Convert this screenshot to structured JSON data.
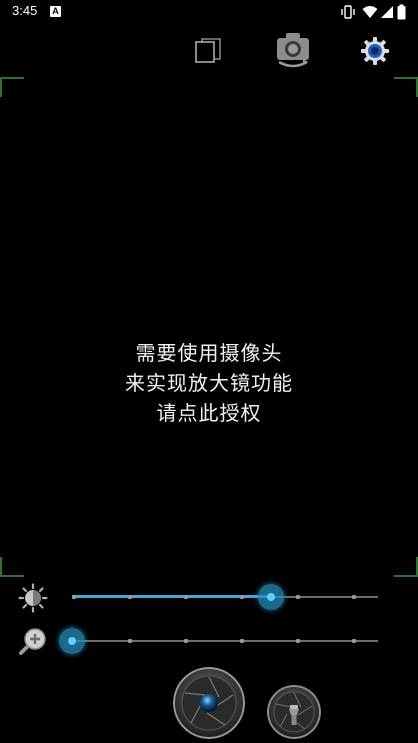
{
  "status_bar": {
    "time": "3:45",
    "notification_icon": "A",
    "icons": [
      "vibrate-icon",
      "wifi-icon",
      "signal-icon",
      "battery-icon"
    ]
  },
  "toolbar": {
    "icons": [
      "frames-icon",
      "camera-switch-icon",
      "settings-gear-icon"
    ]
  },
  "message": {
    "lines": [
      "需要使用摄像头",
      "来实现放大镜功能",
      "请点此授权"
    ]
  },
  "brightness": {
    "icon": "brightness-icon",
    "value_fraction": 0.71,
    "ticks": 6
  },
  "zoom": {
    "icon": "zoom-in-icon",
    "value_fraction": 0.0,
    "ticks": 6
  },
  "bottom_buttons": {
    "capture": "camera-shutter-icon",
    "flashlight": "flashlight-icon"
  },
  "colors": {
    "accent": "#3fa9d8",
    "frame_corner": "#2f6f2f",
    "background": "#000000"
  }
}
